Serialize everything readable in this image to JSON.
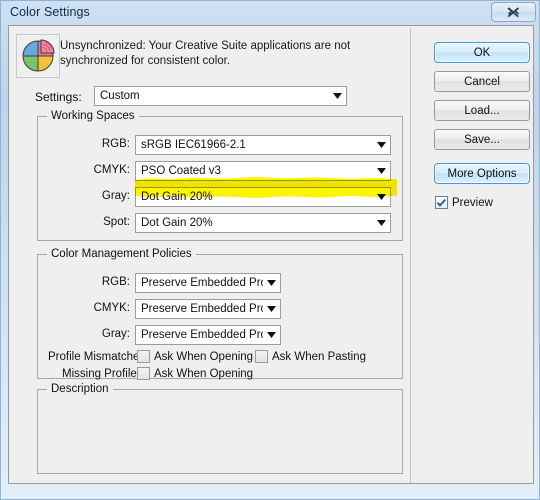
{
  "window": {
    "title": "Color Settings",
    "close_icon": "close-icon"
  },
  "header": {
    "icon": "color-wheel-icon",
    "warning_text": "Unsynchronized: Your Creative Suite applications are not synchronized for consistent color."
  },
  "settings": {
    "label": "Settings:",
    "value": "Custom"
  },
  "working_spaces": {
    "title": "Working Spaces",
    "rows": [
      {
        "label": "RGB:",
        "value": "sRGB IEC61966-2.1"
      },
      {
        "label": "CMYK:",
        "value": "PSO Coated v3"
      },
      {
        "label": "Gray:",
        "value": "Dot Gain 20%"
      },
      {
        "label": "Spot:",
        "value": "Dot Gain 20%"
      }
    ]
  },
  "policies": {
    "title": "Color Management Policies",
    "rows": [
      {
        "label": "RGB:",
        "value": "Preserve Embedded Profiles"
      },
      {
        "label": "CMYK:",
        "value": "Preserve Embedded Profiles"
      },
      {
        "label": "Gray:",
        "value": "Preserve Embedded Profiles"
      }
    ],
    "profile_mismatches": {
      "label": "Profile Mismatches:",
      "ask_opening": {
        "label": "Ask When Opening",
        "checked": false
      },
      "ask_pasting": {
        "label": "Ask When Pasting",
        "checked": false
      }
    },
    "missing_profiles": {
      "label": "Missing Profiles:",
      "ask_opening": {
        "label": "Ask When Opening",
        "checked": false
      }
    }
  },
  "description": {
    "title": "Description",
    "text": ""
  },
  "buttons": {
    "ok": "OK",
    "cancel": "Cancel",
    "load": "Load...",
    "save": "Save...",
    "more_options": "More Options"
  },
  "preview": {
    "label": "Preview",
    "checked": true
  },
  "annotation": {
    "type": "yellow-highlighter",
    "color": "#fdf500",
    "target": "CMYK working space dropdown"
  },
  "colors": {
    "accent": "#3c99dc",
    "dialog_bg": "#efefef",
    "titlebar": "#bcd4ec"
  }
}
